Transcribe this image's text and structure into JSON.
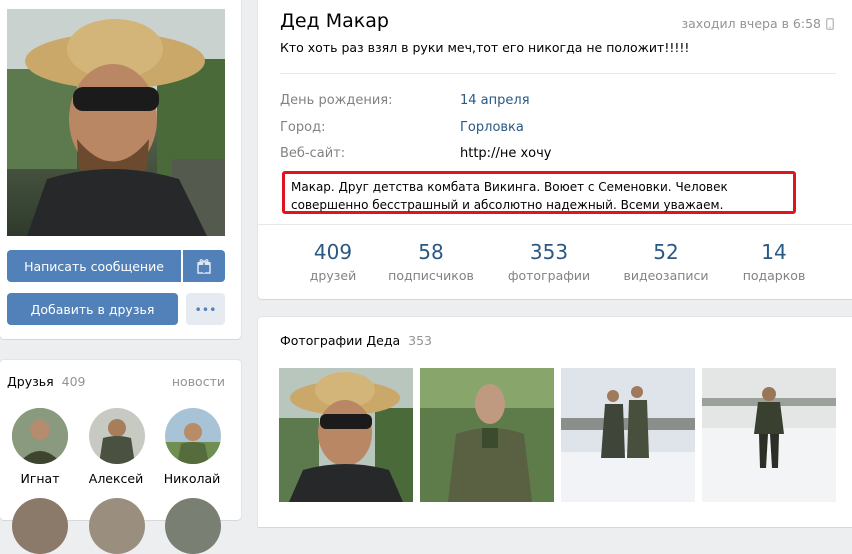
{
  "profile": {
    "name": "Дед Макар",
    "last_seen": "заходил вчера в 6:58",
    "status": "Кто хоть раз взял в руки меч,тот его никогда не положит!!!!!",
    "info": [
      {
        "label": "День рождения:",
        "value": "14 апреля"
      },
      {
        "label": "Город:",
        "value": "Горловка"
      },
      {
        "label": "Веб-сайт:",
        "value": "http://не хочу"
      }
    ],
    "about": "Макар. Друг детства комбата Викинга. Воюет с Семеновки. Человек совершенно бесстрашный и абсолютно надежный. Всеми уважаем.",
    "counters": [
      {
        "num": "409",
        "label": "друзей"
      },
      {
        "num": "58",
        "label": "подписчиков"
      },
      {
        "num": "353",
        "label": "фотографии"
      },
      {
        "num": "52",
        "label": "видеозаписи"
      },
      {
        "num": "14",
        "label": "подарков"
      }
    ]
  },
  "actions": {
    "send_message": "Написать сообщение",
    "add_friend": "Добавить в друзья",
    "more": "•••"
  },
  "friends": {
    "title": "Друзья",
    "count": "409",
    "news_link": "новости",
    "items": [
      {
        "name": "Игнат"
      },
      {
        "name": "Алексей"
      },
      {
        "name": "Николай"
      }
    ]
  },
  "photos": {
    "title": "Фотографии Деда",
    "count": "353"
  },
  "colors": {
    "accent": "#5181b8",
    "link": "#2a5885",
    "highlight_border": "#e0141e"
  }
}
